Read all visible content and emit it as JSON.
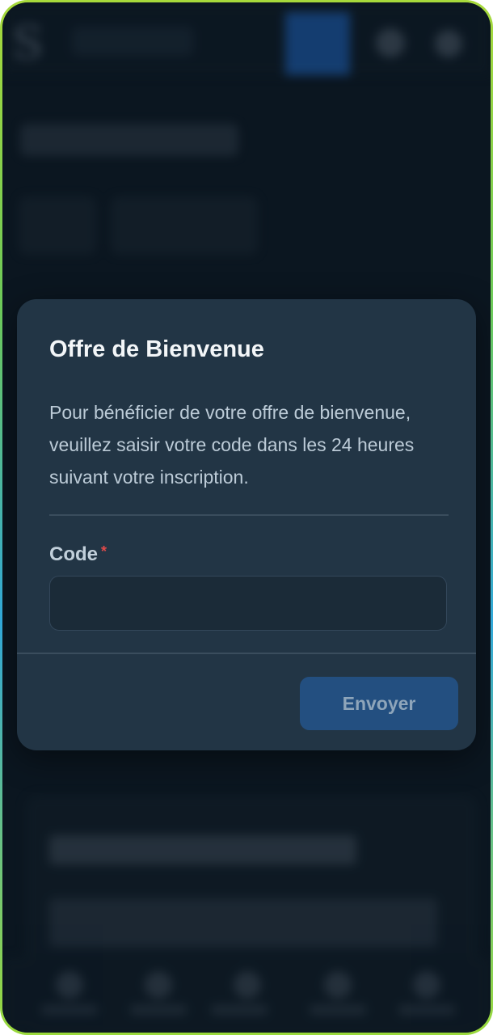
{
  "modal": {
    "title": "Offre de Bienvenue",
    "description": "Pour bénéficier de votre offre de bienvenue, veuillez saisir votre code dans les 24 heures suivant votre inscription.",
    "code_field": {
      "label": "Code",
      "required_mark": "*",
      "value": "",
      "placeholder": ""
    },
    "submit_label": "Envoyer"
  },
  "colors": {
    "modal_background": "#223545",
    "submit_button": "#234f80",
    "required_mark": "#e24a4a",
    "frame_gradient_start": "#a7d93b",
    "frame_gradient_mid": "#31a7d8"
  }
}
